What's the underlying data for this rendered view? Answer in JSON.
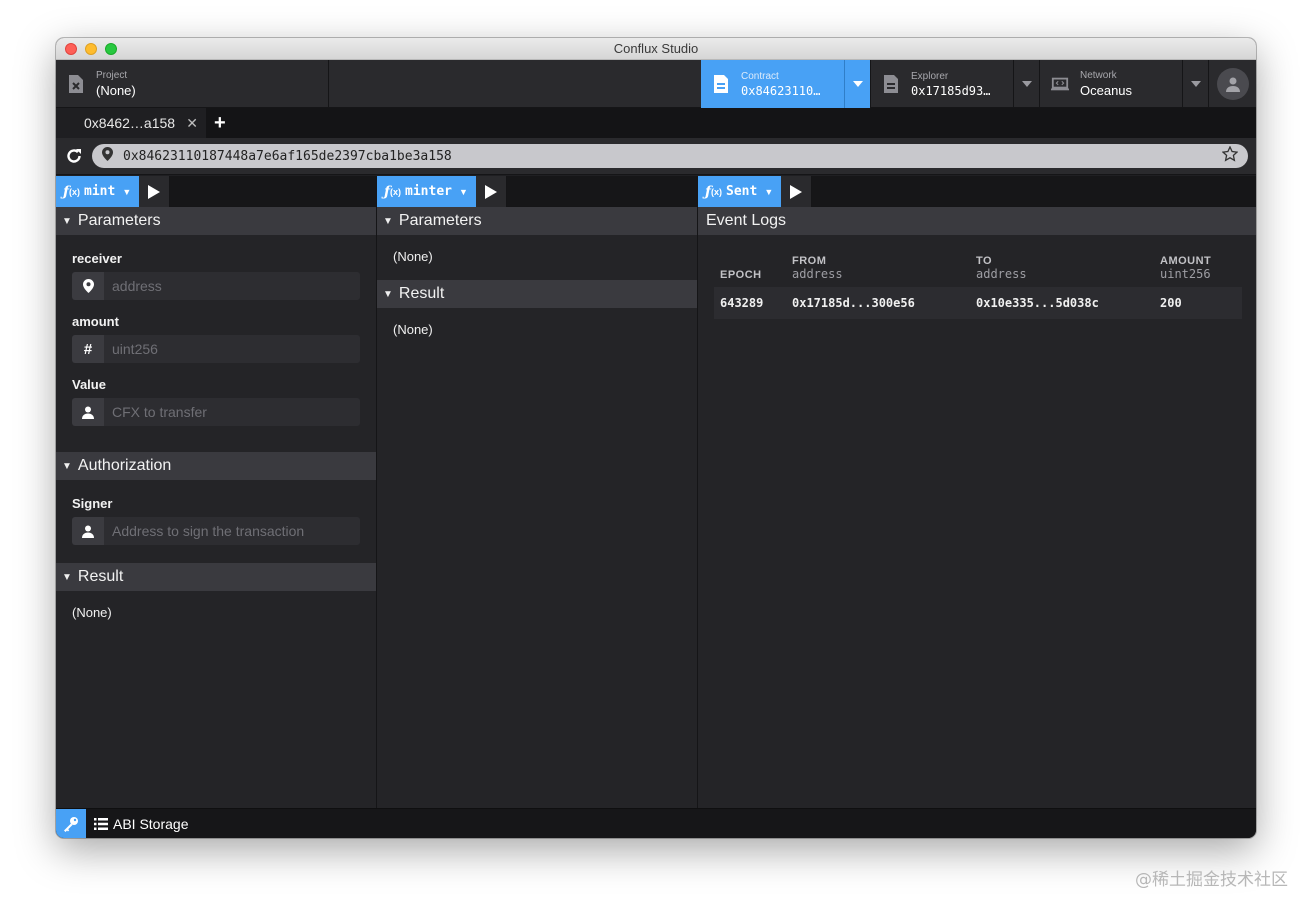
{
  "window": {
    "title": "Conflux Studio"
  },
  "header": {
    "project": {
      "label": "Project",
      "value": "(None)",
      "icon": "project-x-icon"
    },
    "contract": {
      "label": "Contract",
      "value": "0x84623110…",
      "icon": "contract-icon"
    },
    "explorer": {
      "label": "Explorer",
      "value": "0x17185d93…",
      "icon": "explorer-icon"
    },
    "network": {
      "label": "Network",
      "value": "Oceanus",
      "icon": "network-icon"
    }
  },
  "tabs": [
    {
      "label": "0x8462…a158",
      "close": "✕"
    }
  ],
  "tab_add": "+",
  "address": {
    "url": "0x84623110187448a7e6af165de2397cba1be3a158"
  },
  "panes": [
    {
      "function": {
        "prefix": "ƒ",
        "x": "(x)",
        "name": "mint"
      },
      "parameters": {
        "title": "Parameters",
        "fields": [
          {
            "label": "receiver",
            "placeholder": "address",
            "icon": "map-marker-icon"
          },
          {
            "label": "amount",
            "placeholder": "uint256",
            "icon": "hash-icon"
          },
          {
            "label": "Value",
            "placeholder": "CFX to transfer",
            "icon": "user-icon"
          }
        ]
      },
      "authorization": {
        "title": "Authorization",
        "signer_label": "Signer",
        "signer_placeholder": "Address to sign the transaction"
      },
      "result": {
        "title": "Result",
        "value": "(None)"
      }
    },
    {
      "function": {
        "prefix": "ƒ",
        "x": "(x)",
        "name": "minter"
      },
      "parameters": {
        "title": "Parameters",
        "value": "(None)"
      },
      "result": {
        "title": "Result",
        "value": "(None)"
      }
    },
    {
      "function": {
        "prefix": "ƒ",
        "x": "(x)",
        "name": "Sent"
      },
      "event_logs": {
        "title": "Event Logs",
        "columns": [
          {
            "name": "EPOCH",
            "type": ""
          },
          {
            "name": "FROM",
            "type": "address"
          },
          {
            "name": "TO",
            "type": "address"
          },
          {
            "name": "AMOUNT",
            "type": "uint256"
          }
        ],
        "rows": [
          {
            "epoch": "643289",
            "from": "0x17185d...300e56",
            "to": "0x10e335...5d038c",
            "amount": "200"
          }
        ]
      }
    }
  ],
  "footer": {
    "abi_storage": "ABI Storage",
    "key_icon": "key-icon",
    "list_icon": "list-icon"
  },
  "watermark": "@稀土掘金技术社区",
  "colors": {
    "accent": "#48a1f5",
    "panel": "#242427",
    "section": "#3a3a3f"
  }
}
